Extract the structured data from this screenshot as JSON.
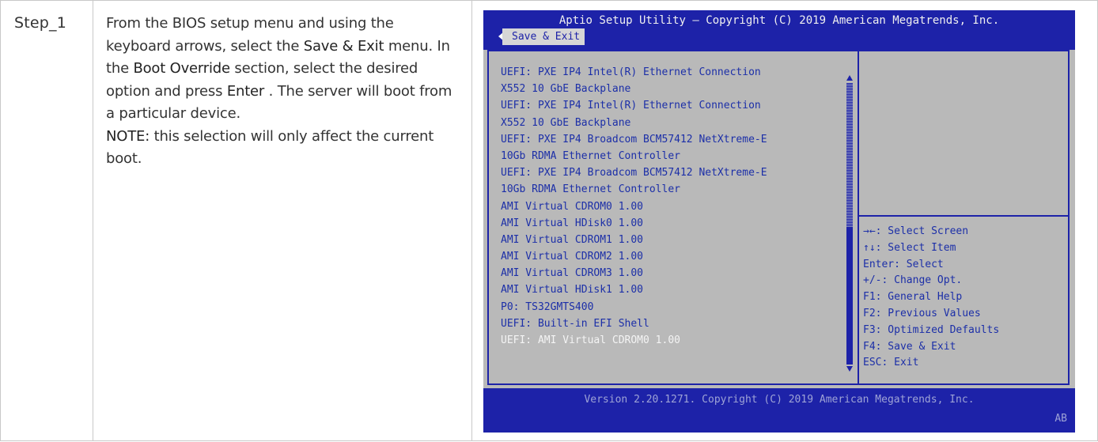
{
  "step": {
    "label": "Step_1"
  },
  "instructions": {
    "p1": "From the BIOS setup menu and using the keyboard arrows, select the ",
    "kw1": "Save & Exit",
    "p2": " menu. In the ",
    "kw2": "Boot Override",
    "p3": " section, select the desired option and press ",
    "kw3": "Enter",
    "p4": " . The server will boot from a particular device.",
    "note_label": "NOTE:",
    "note_text": " this selection will only affect the current boot."
  },
  "bios": {
    "title": "Aptio Setup Utility – Copyright (C) 2019 American Megatrends, Inc.",
    "active_tab": "Save & Exit",
    "boot_items": [
      "UEFI: PXE IP4 Intel(R) Ethernet Connection",
      "X552 10 GbE Backplane",
      "UEFI: PXE IP4 Intel(R) Ethernet Connection",
      "X552 10 GbE Backplane",
      "UEFI: PXE IP4 Broadcom BCM57412 NetXtreme-E",
      "10Gb RDMA Ethernet Controller",
      "UEFI: PXE IP4 Broadcom BCM57412 NetXtreme-E",
      "10Gb RDMA Ethernet Controller",
      "AMI Virtual CDROM0 1.00",
      "AMI Virtual HDisk0 1.00",
      "AMI Virtual CDROM1 1.00",
      "AMI Virtual CDROM2 1.00",
      "AMI Virtual CDROM3 1.00",
      "AMI Virtual HDisk1 1.00",
      "P0: TS32GMTS400",
      "UEFI: Built-in EFI Shell",
      "UEFI: AMI Virtual CDROM0 1.00"
    ],
    "selected_index": 16,
    "help_items": [
      "→←: Select Screen",
      "↑↓: Select Item",
      "Enter: Select",
      "+/-: Change Opt.",
      "F1: General Help",
      "F2: Previous Values",
      "F3: Optimized Defaults",
      "F4: Save & Exit",
      "ESC: Exit"
    ],
    "version": "Version 2.20.1271. Copyright (C) 2019 American Megatrends, Inc.",
    "code": "AB",
    "colors": {
      "header_blue": "#1d22a8",
      "panel_gray": "#b9b9b9",
      "text_blue": "#1c2fa8"
    }
  }
}
